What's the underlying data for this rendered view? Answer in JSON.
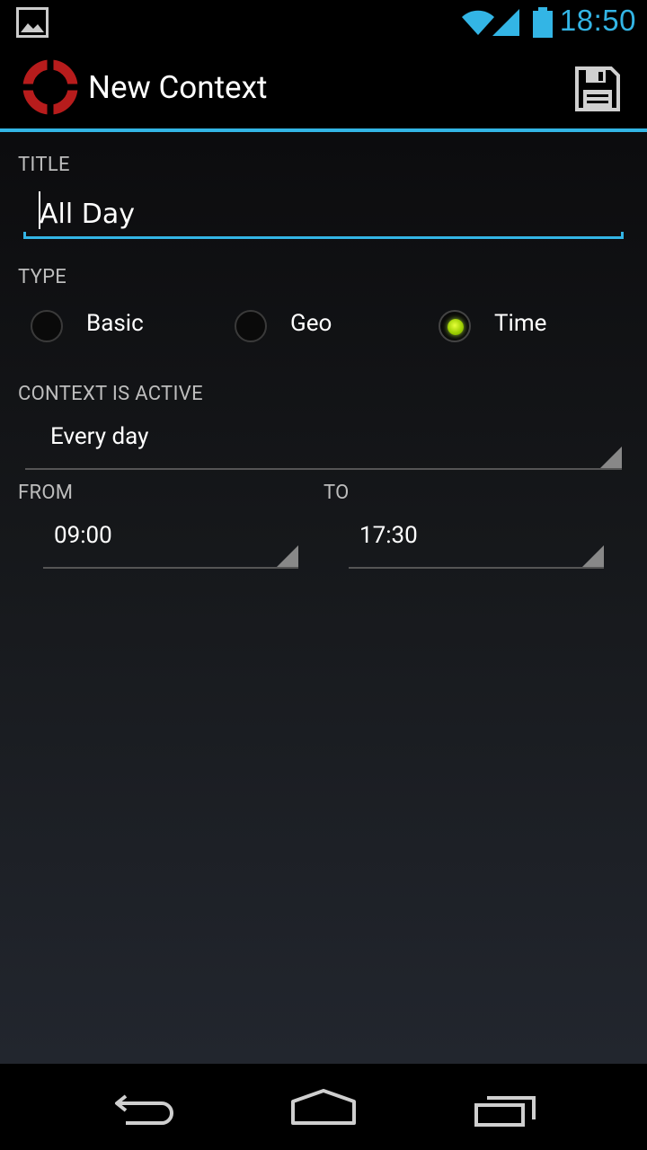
{
  "status_bar": {
    "time": "18:50",
    "icons": [
      "gallery-icon",
      "wifi-icon",
      "signal-icon",
      "battery-icon"
    ],
    "accent_color": "#33b5e5"
  },
  "action_bar": {
    "title": "New Context",
    "logo_icon": "lifebuoy-icon",
    "save_icon": "floppy-disk-icon"
  },
  "form": {
    "title_label": "TITLE",
    "title_value": "All Day",
    "type_label": "TYPE",
    "type_options": [
      {
        "label": "Basic",
        "checked": false
      },
      {
        "label": "Geo",
        "checked": false
      },
      {
        "label": "Time",
        "checked": true
      }
    ],
    "active_label": "CONTEXT IS ACTIVE",
    "active_value": "Every day",
    "from_label": "FROM",
    "from_value": "09:00",
    "to_label": "TO",
    "to_value": "17:30"
  },
  "nav_bar": {
    "icons": [
      "back-icon",
      "home-icon",
      "recent-apps-icon"
    ]
  }
}
